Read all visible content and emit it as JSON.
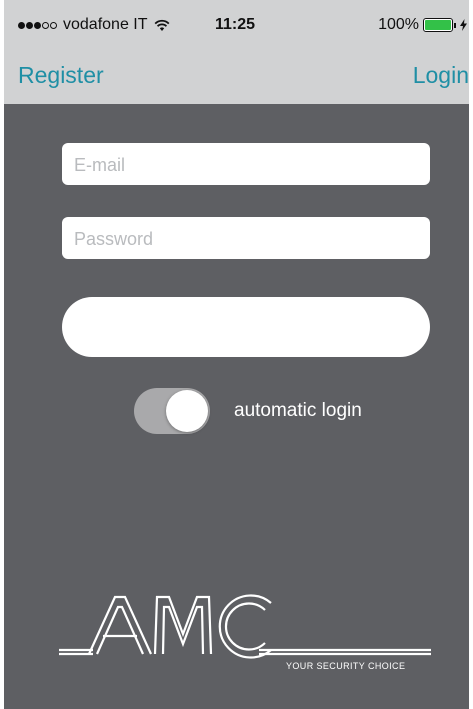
{
  "status_bar": {
    "carrier": "vodafone IT",
    "time": "11:25",
    "battery_percent": "100%",
    "battery_level": 1.0,
    "signal_bars": 3,
    "signal_total": 5,
    "icons": [
      "signal-dots-icon",
      "wifi-icon",
      "battery-icon",
      "charging-bolt-icon"
    ]
  },
  "nav": {
    "left_label": "Register",
    "right_label": "Login"
  },
  "form": {
    "email_placeholder": "E-mail",
    "email_value": "",
    "password_placeholder": "Password",
    "password_value": "",
    "submit_label": ""
  },
  "auto_login": {
    "label": "automatic login",
    "enabled": true
  },
  "logo": {
    "wordmark": "AMC",
    "tagline": "YOUR SECURITY CHOICE"
  },
  "colors": {
    "background": "#5e5f63",
    "top_bar": "#d1d2d3",
    "accent": "#1f8fa5",
    "battery": "#33c148"
  }
}
